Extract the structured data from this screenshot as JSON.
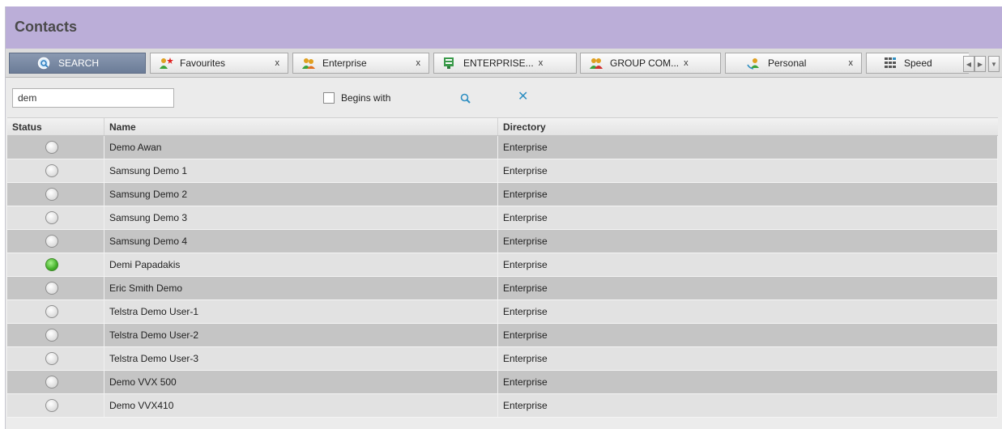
{
  "header": {
    "title": "Contacts"
  },
  "tabs": [
    {
      "label": "SEARCH",
      "icon": "search-icon",
      "closable": false,
      "active": true
    },
    {
      "label": "Favourites",
      "icon": "favourites-icon",
      "close": "x"
    },
    {
      "label": "Enterprise",
      "icon": "enterprise-icon",
      "close": "x"
    },
    {
      "label": "ENTERPRISE...",
      "icon": "enterprise-directory-icon",
      "close": "x"
    },
    {
      "label": "GROUP COM...",
      "icon": "group-common-icon",
      "close": "x"
    },
    {
      "label": "Personal",
      "icon": "personal-icon",
      "close": "x"
    },
    {
      "label": "Speed",
      "icon": "speed-dial-icon"
    }
  ],
  "search": {
    "query": "dem",
    "begins_with_label": "Begins with",
    "begins_with_checked": false
  },
  "table": {
    "columns": [
      "Status",
      "Name",
      "Directory"
    ],
    "rows": [
      {
        "status": "offline",
        "name": "Demo Awan",
        "directory": "Enterprise"
      },
      {
        "status": "offline",
        "name": "Samsung Demo 1",
        "directory": "Enterprise"
      },
      {
        "status": "offline",
        "name": "Samsung Demo 2",
        "directory": "Enterprise"
      },
      {
        "status": "offline",
        "name": "Samsung Demo 3",
        "directory": "Enterprise"
      },
      {
        "status": "offline",
        "name": "Samsung Demo 4",
        "directory": "Enterprise"
      },
      {
        "status": "online",
        "name": "Demi Papadakis",
        "directory": "Enterprise"
      },
      {
        "status": "offline",
        "name": "Eric Smith Demo",
        "directory": "Enterprise"
      },
      {
        "status": "offline",
        "name": "Telstra Demo User-1",
        "directory": "Enterprise"
      },
      {
        "status": "offline",
        "name": "Telstra Demo User-2",
        "directory": "Enterprise"
      },
      {
        "status": "offline",
        "name": "Telstra Demo User-3",
        "directory": "Enterprise"
      },
      {
        "status": "offline",
        "name": "Demo VVX 500",
        "directory": "Enterprise"
      },
      {
        "status": "offline",
        "name": "Demo VVX410",
        "directory": "Enterprise"
      }
    ]
  },
  "colors": {
    "header_bg": "#bbaed8",
    "active_tab": "#7888a3",
    "online_status": "#44b02a",
    "clear_icon": "#2f8fc2"
  }
}
